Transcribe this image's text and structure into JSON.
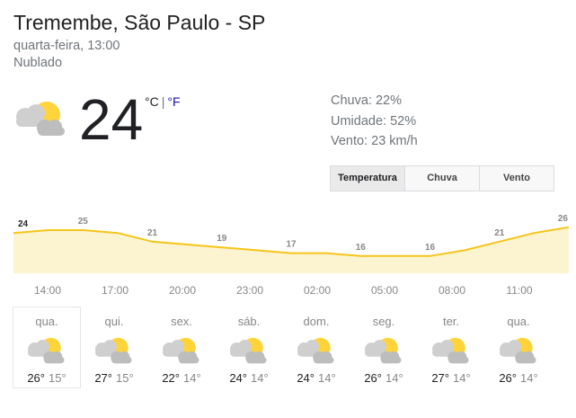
{
  "location": "Tremembe, São Paulo - SP",
  "datetime": "quarta-feira, 13:00",
  "condition": "Nublado",
  "current": {
    "temperature": "24",
    "unit_c": "°C",
    "unit_sep": "|",
    "unit_f": "°F",
    "icon": "partly-cloudy-icon"
  },
  "details": {
    "rain": "Chuva: 22%",
    "humidity": "Umidade: 52%",
    "wind": "Vento: 23 km/h"
  },
  "tabs": [
    "Temperatura",
    "Chuva",
    "Vento"
  ],
  "active_tab": "Temperatura",
  "chart_data": {
    "type": "area",
    "series": [
      {
        "values": [
          24,
          25,
          25,
          24,
          21,
          20,
          19,
          18,
          17,
          17,
          16,
          16,
          16,
          18,
          21,
          24,
          26
        ]
      }
    ],
    "labels": [
      "24",
      "25",
      "21",
      "19",
      "17",
      "16",
      "16",
      "21",
      "26"
    ],
    "hours": [
      "14:00",
      "17:00",
      "20:00",
      "23:00",
      "02:00",
      "05:00",
      "08:00",
      "11:00"
    ],
    "colors": {
      "line": "#f5c518",
      "fill": "#fcf4d0",
      "labels": "#878787",
      "first_label": "#202124"
    }
  },
  "days": [
    {
      "name": "qua.",
      "hi": "26°",
      "lo": "15°",
      "icon": "partly-cloudy-icon"
    },
    {
      "name": "qui.",
      "hi": "27°",
      "lo": "15°",
      "icon": "partly-cloudy-icon"
    },
    {
      "name": "sex.",
      "hi": "22°",
      "lo": "14°",
      "icon": "partly-cloudy-icon"
    },
    {
      "name": "sáb.",
      "hi": "24°",
      "lo": "14°",
      "icon": "partly-cloudy-icon"
    },
    {
      "name": "dom.",
      "hi": "24°",
      "lo": "14°",
      "icon": "partly-cloudy-icon"
    },
    {
      "name": "seg.",
      "hi": "26°",
      "lo": "14°",
      "icon": "partly-cloudy-icon"
    },
    {
      "name": "ter.",
      "hi": "27°",
      "lo": "14°",
      "icon": "partly-cloudy-icon"
    },
    {
      "name": "qua.",
      "hi": "26°",
      "lo": "14°",
      "icon": "partly-cloudy-icon"
    }
  ]
}
